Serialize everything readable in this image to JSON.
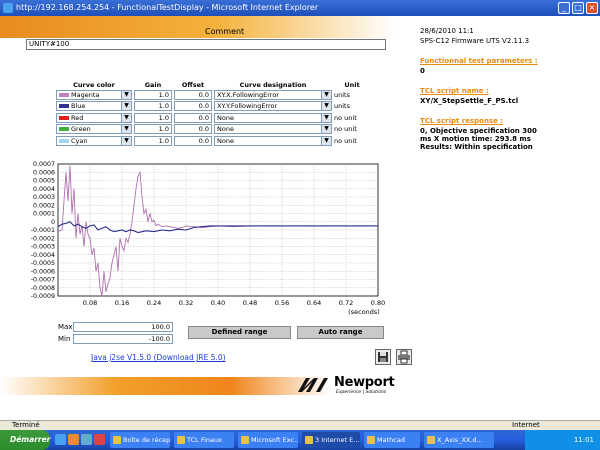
{
  "window": {
    "title": "http://192.168.254.254 - FunctionalTestDisplay - Microsoft Internet Explorer"
  },
  "comment": {
    "label": "Comment",
    "value": "UNITY#100"
  },
  "info": {
    "date": "28/6/2010 11:1",
    "firmware": "SPS-C12 Firmware UTS V2.11.3",
    "params_label": "Functionnal test parameters :",
    "params_value": "0",
    "script_name_label": "TCL script name :",
    "script_name_value": "XY/X_StepSettle_F_PS.tcl",
    "response_label": "TCL script response :",
    "response_line1": "0, Objective specification 300",
    "response_line2": "ms X motion time: 293.8 ms",
    "response_line3": "Results: Within specification"
  },
  "curves_table": {
    "headers": {
      "color": "Curve color",
      "gain": "Gain",
      "offset": "Offset",
      "designation": "Curve designation",
      "unit": "Unit"
    },
    "rows": [
      {
        "color_name": "Magenta",
        "swatch": "#c080c0",
        "gain": "1.0",
        "offset": "0.0",
        "designation": "XY.X.FollowingError",
        "unit": "units"
      },
      {
        "color_name": "Blue",
        "swatch": "#303090",
        "gain": "1.0",
        "offset": "0.0",
        "designation": "XY.Y.FollowingError",
        "unit": "units"
      },
      {
        "color_name": "Red",
        "swatch": "#e02020",
        "gain": "1.0",
        "offset": "0.0",
        "designation": "None",
        "unit": "no unit"
      },
      {
        "color_name": "Green",
        "swatch": "#40b040",
        "gain": "1.0",
        "offset": "0.0",
        "designation": "None",
        "unit": "no unit"
      },
      {
        "color_name": "Cyan",
        "swatch": "#a0d8f0",
        "gain": "1.0",
        "offset": "0.0",
        "designation": "None",
        "unit": "no unit"
      }
    ]
  },
  "chart_data": {
    "type": "line",
    "xlabel": "(seconds)",
    "xlim": [
      0,
      0.8
    ],
    "ylim": [
      -0.0009,
      0.0007
    ],
    "x_ticks": [
      "0.08",
      "0.16",
      "0.24",
      "0.32",
      "0.40",
      "0.48",
      "0.56",
      "0.64",
      "0.72",
      "0.80"
    ],
    "y_ticks": [
      "0.0007",
      "0.0006",
      "0.0005",
      "0.0004",
      "0.0003",
      "0.0002",
      "0.0001",
      "0",
      "-0.0001",
      "-0.0002",
      "-0.0003",
      "-0.0004",
      "-0.0005",
      "-0.0006",
      "-0.0007",
      "-0.0008",
      "-0.0009"
    ],
    "grid": true,
    "series": [
      {
        "name": "XY.X.FollowingError",
        "color": "#b070b0",
        "x": [
          0,
          0.01,
          0.02,
          0.025,
          0.03,
          0.035,
          0.04,
          0.045,
          0.05,
          0.055,
          0.06,
          0.065,
          0.07,
          0.075,
          0.08,
          0.085,
          0.09,
          0.095,
          0.1,
          0.105,
          0.11,
          0.115,
          0.12,
          0.125,
          0.13,
          0.135,
          0.14,
          0.145,
          0.15,
          0.155,
          0.16,
          0.165,
          0.17,
          0.175,
          0.18,
          0.185,
          0.19,
          0.195,
          0.2,
          0.205,
          0.21,
          0.215,
          0.22,
          0.225,
          0.23,
          0.235,
          0.24,
          0.245,
          0.25,
          0.26,
          0.27,
          0.28,
          0.29,
          0.3,
          0.31,
          0.32,
          0.34,
          0.36,
          0.38,
          0.4,
          0.44,
          0.48,
          0.52,
          0.56,
          0.6,
          0.64,
          0.68,
          0.72,
          0.76,
          0.8
        ],
        "y": [
          -0.00012,
          -0.0001,
          0.0006,
          0.00025,
          0.00068,
          0.0001,
          0.0004,
          -0.0002,
          0.0001,
          -0.00015,
          -5e-05,
          -0.0003,
          0.0,
          -0.00015,
          -0.0002,
          -0.0004,
          -0.00032,
          -0.0006,
          -0.0005,
          -0.0008,
          -0.0009,
          -0.0006,
          -0.00085,
          -0.00075,
          -0.00068,
          -0.0005,
          -0.0004,
          -0.0003,
          -0.0006,
          -0.0002,
          -0.0003,
          -0.00035,
          -0.0002,
          -0.00025,
          -0.00015,
          0.0,
          0.0002,
          0.0004,
          0.00055,
          0.0006,
          0.0003,
          0.0001,
          0.00015,
          0.0,
          0.0001,
          0.0,
          2e-05,
          -5e-05,
          -3e-05,
          -6e-05,
          -5e-05,
          -6e-05,
          -7e-05,
          -8e-05,
          -7e-05,
          -5e-05,
          -6e-05,
          -7e-05,
          -6e-05,
          -5e-05,
          -6e-05,
          -5e-05,
          -5e-05,
          -5e-05,
          -5e-05,
          -5e-05,
          -5e-05,
          -5e-05,
          -5e-05,
          -5e-05
        ]
      },
      {
        "name": "XY.Y.FollowingError",
        "color": "#2a2a8a",
        "x": [
          0,
          0.01,
          0.02,
          0.03,
          0.04,
          0.05,
          0.06,
          0.07,
          0.08,
          0.09,
          0.1,
          0.11,
          0.12,
          0.13,
          0.14,
          0.15,
          0.16,
          0.17,
          0.18,
          0.19,
          0.2,
          0.22,
          0.24,
          0.26,
          0.28,
          0.3,
          0.32,
          0.34,
          0.36,
          0.38,
          0.4,
          0.44,
          0.48,
          0.52,
          0.56,
          0.6,
          0.64,
          0.68,
          0.72,
          0.76,
          0.8
        ],
        "y": [
          -6e-05,
          -3e-05,
          -2e-05,
          0.0,
          -5e-05,
          -3e-05,
          -6e-05,
          -8e-05,
          -5e-05,
          -4e-05,
          -0.0001,
          -8e-05,
          -6e-05,
          -0.0001,
          -0.00012,
          -0.00011,
          -0.0001,
          -0.00012,
          -0.0001,
          -0.00011,
          -0.00013,
          -0.00011,
          -0.00012,
          -0.0001,
          -0.00011,
          -9e-05,
          -0.0001,
          -7e-05,
          -6e-05,
          -5e-05,
          -5e-05,
          -5e-05,
          -5e-05,
          -5e-05,
          -5e-05,
          -5e-05,
          -5e-05,
          -5e-05,
          -5e-05,
          -5e-05,
          -5e-05
        ]
      }
    ]
  },
  "range": {
    "max_label": "Max",
    "max_value": "100.0",
    "min_label": "Min",
    "min_value": "-100.0",
    "defined_label": "Defined range",
    "auto_label": "Auto range"
  },
  "java_link": "Java j2se V1.5.0 (Download JRE 5.0)",
  "logo": {
    "word": "Newport",
    "tagline": "Experience | Solutions"
  },
  "statusbar": {
    "left": "Terminé",
    "right": "Internet"
  },
  "taskbar": {
    "start": "Démarrer",
    "tasks": [
      "Boîte de récep...",
      "TCL Finaux",
      "Microsoft Exc...",
      "3 Internet E...",
      "Mathcad",
      "X_Axis_XX.d..."
    ],
    "clock": "11:01"
  }
}
